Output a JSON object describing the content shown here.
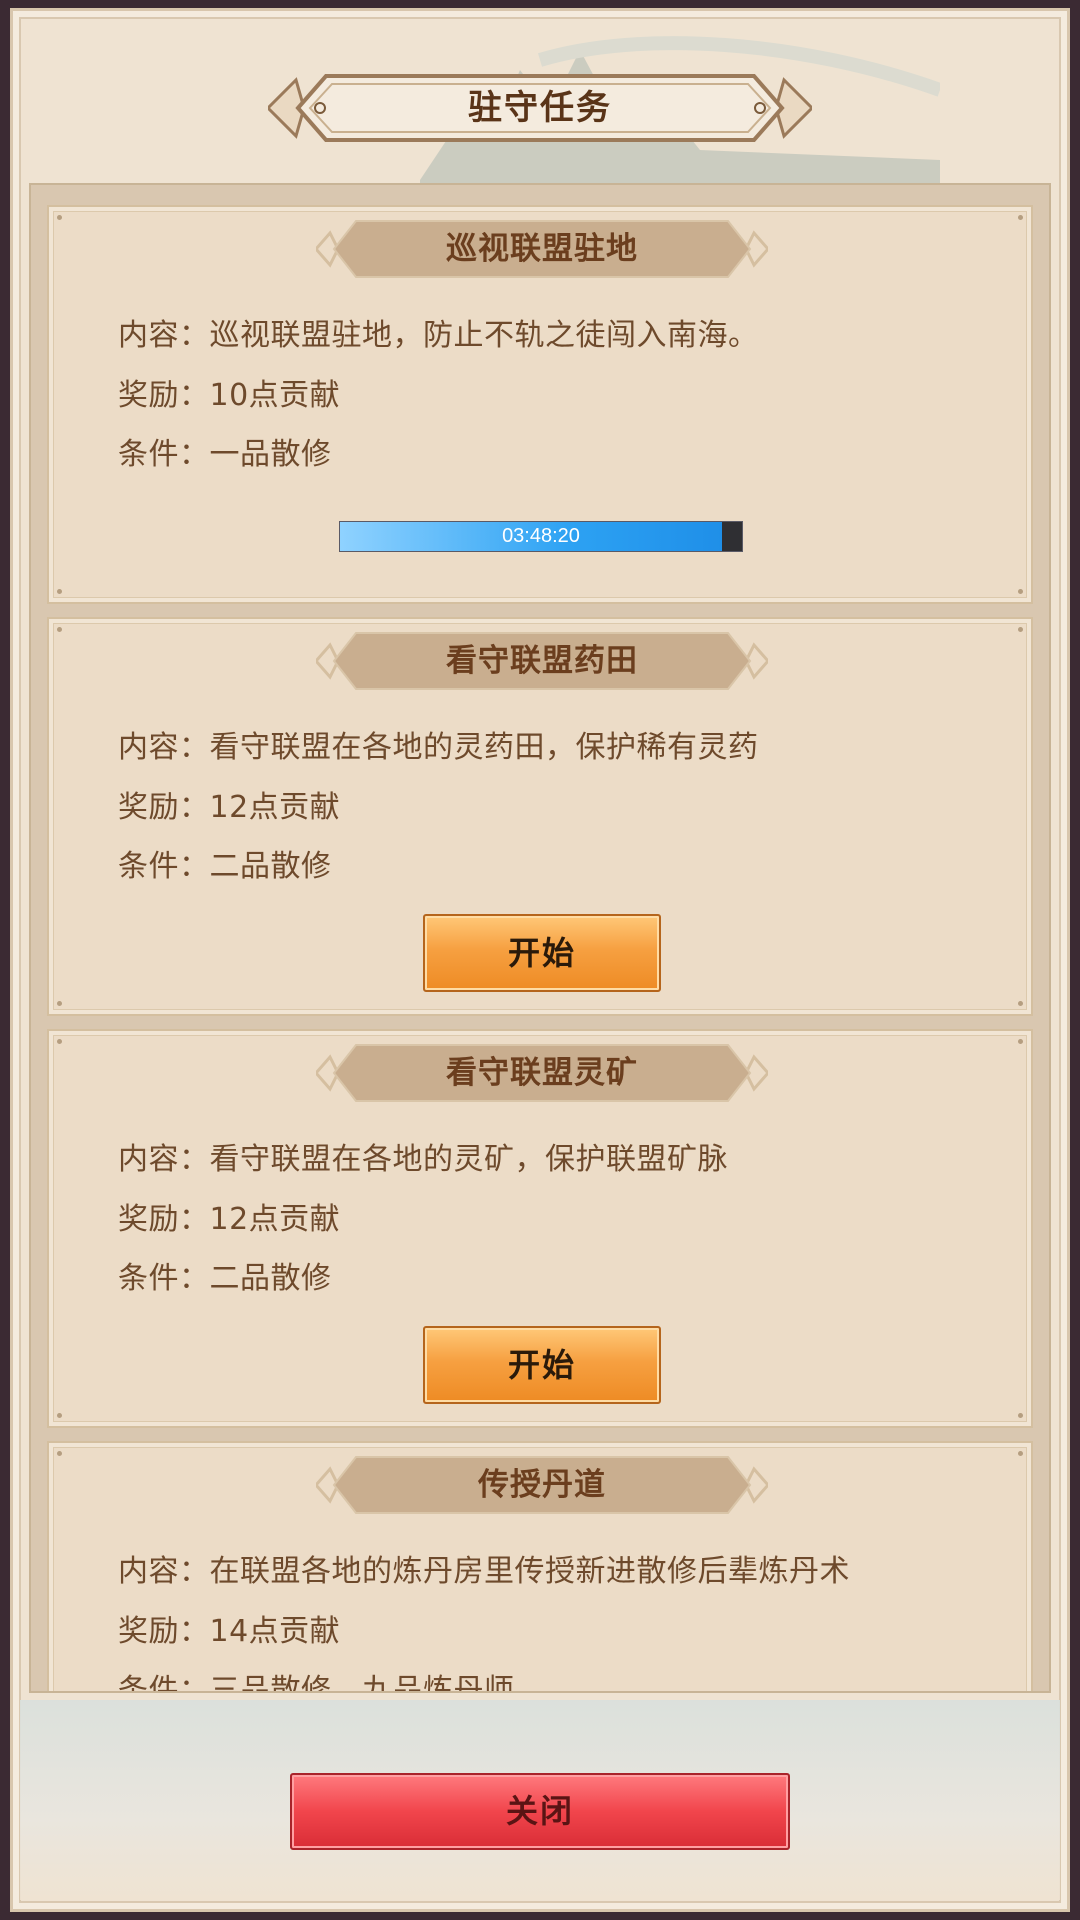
{
  "dialog": {
    "title": "驻守任务"
  },
  "tasks": [
    {
      "title": "巡视联盟驻地",
      "content": "内容：巡视联盟驻地，防止不轨之徒闯入南海。",
      "reward": "奖励：10点贡献",
      "condition": "条件：一品散修",
      "status": "in_progress",
      "timer": "03:48:20",
      "progress": 0.95
    },
    {
      "title": "看守联盟药田",
      "content": "内容：看守联盟在各地的灵药田，保护稀有灵药",
      "reward": "奖励：12点贡献",
      "condition": "条件：二品散修",
      "status": "available",
      "button_label": "开始"
    },
    {
      "title": "看守联盟灵矿",
      "content": "内容：看守联盟在各地的灵矿，保护联盟矿脉",
      "reward": "奖励：12点贡献",
      "condition": "条件：二品散修",
      "status": "available",
      "button_label": "开始"
    },
    {
      "title": "传授丹道",
      "content": "内容：在联盟各地的炼丹房里传授新进散修后辈炼丹术",
      "reward": "奖励：14点贡献",
      "condition": "条件：三品散修，九品炼丹师",
      "status": "available"
    }
  ],
  "footer": {
    "close_label": "关闭"
  },
  "colors": {
    "progress_fill": "#2da2f3",
    "start_button": "#f6a041",
    "close_button": "#f1454c",
    "card_bg": "#ecdcc7"
  }
}
